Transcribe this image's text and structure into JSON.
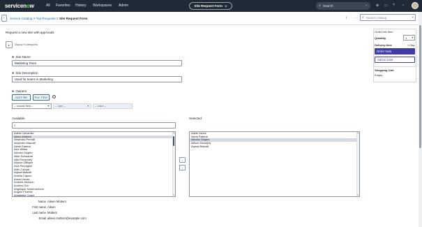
{
  "topbar": {
    "logo": "servicenow",
    "nav": [
      "All",
      "Favorites",
      "History",
      "Workspaces",
      "Admin"
    ],
    "context_pill": "Site Request Form",
    "search_label": "Search"
  },
  "subheader": {
    "breadcrumb": {
      "links": [
        "Service Catalog",
        "Top Requests"
      ],
      "current": "Site Request Form",
      "separator": ">"
    },
    "catalog_search_placeholder": "Search catalog"
  },
  "form": {
    "title": "Request a new site with approvals",
    "toggle_label": "Display in categories",
    "site_name": {
      "label": "Site Name",
      "value": "Marketing Team"
    },
    "site_description": {
      "label": "Site Description",
      "value": "Used for teams in Marketing"
    },
    "owners": {
      "label": "Owners",
      "add_filter": "Add Filter",
      "run_filter": "Run Filter",
      "field_select": "-- choose field --",
      "oper_select": "-- oper --",
      "value_select": "-- value --"
    },
    "available": {
      "label": "Available",
      "items": [
        "Adela Cervantsz",
        "Aileen Mottern",
        "Alejandra Prenatt",
        "Alejandro Mascall",
        "Alene Rabeck",
        "Alex Wilber",
        "Alfonso Griglen",
        "Allan Schwantd",
        "Allie Pumphrey",
        "Allyson Gillispie",
        "Alva Pennigton",
        "Alvin Campa",
        "Alyssa Biasotti",
        "Amelia Caputo",
        "Amos Linnan",
        "Andrew Jackson",
        "Andrew Och",
        "Angelique Schermerhorn",
        "Angelo Ferentz",
        "Annabelle Coger"
      ],
      "selected_index": 1
    },
    "selected": {
      "label": "Selected",
      "items": [
        "Adele Vance",
        "Alene Rabeck",
        "Alfonso Griglen",
        "Allison Mountjoy",
        "Alyssa Biasotti"
      ],
      "selected_index": 2
    },
    "details": [
      {
        "key": "Name",
        "value": "Aileen Mottern"
      },
      {
        "key": "First name",
        "value": "Aileen"
      },
      {
        "key": "Last name",
        "value": "Mottern"
      },
      {
        "key": "Email",
        "value": "aileen.mottern@example.com"
      }
    ]
  },
  "order_panel": {
    "title": "Order this Item",
    "quantity_label": "Quantity",
    "quantity_value": "1",
    "delivery_label": "Delivery time",
    "delivery_value": "1 Day",
    "order_now": "Order Now",
    "add_to_cart": "Add to Cart",
    "cart_title": "Shopping Cart",
    "cart_status": "Empty"
  },
  "colors": {
    "topbar": "#1f2a36",
    "accent": "#3f3ba8",
    "link": "#1a6fb8"
  }
}
